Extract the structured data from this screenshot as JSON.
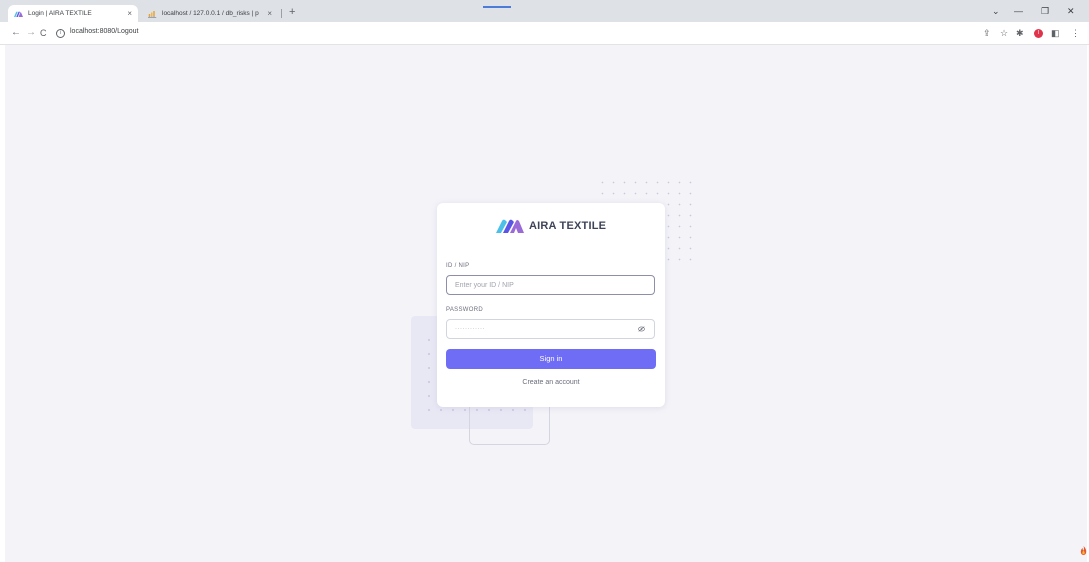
{
  "browser": {
    "tabs": [
      {
        "title": "Login | AIRA TEXTILE",
        "active": true
      },
      {
        "title": "localhost / 127.0.0.1 / db_risks | p",
        "active": false
      }
    ],
    "close_glyph": "×",
    "new_tab_glyph": "+",
    "window_controls": {
      "dropdown": "⌄",
      "minimize": "—",
      "restore": "❐",
      "close": "✕"
    },
    "nav": {
      "back": "←",
      "forward": "→",
      "reload": "C",
      "info": "i"
    },
    "address": "localhost:8080/Logout",
    "toolbar_icons": {
      "share": "⇪",
      "bookmark": "☆",
      "extensions": "✱",
      "sidepanel": "◧",
      "menu": "⋮"
    },
    "profile_initial": "I"
  },
  "brand": {
    "name": "AIRA TEXTILE",
    "logo_colors": [
      "#5a55e6",
      "#9a6ad8",
      "#4cc0e8"
    ]
  },
  "form": {
    "id_label": "ID / NIP",
    "id_placeholder": "Enter your ID / NIP",
    "password_label": "PASSWORD",
    "password_placeholder": "············",
    "signin_label": "Sign in",
    "create_account_label": "Create an account"
  },
  "colors": {
    "accent": "#6f6df5",
    "background": "#f4f3f8"
  }
}
